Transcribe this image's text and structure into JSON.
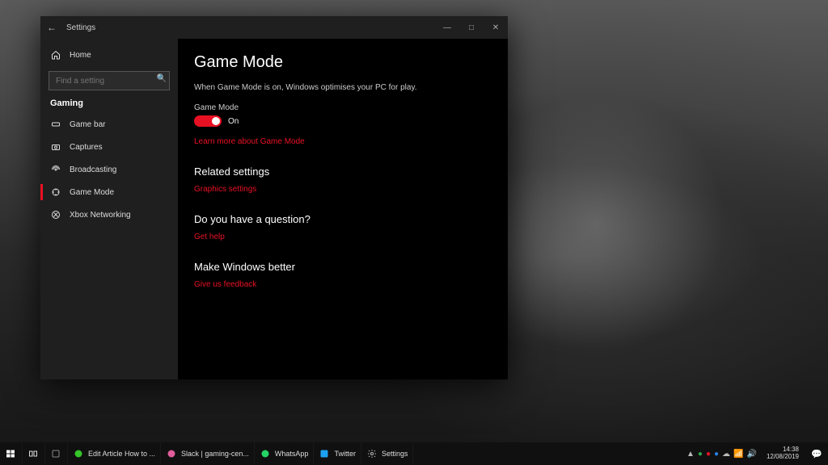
{
  "window": {
    "title": "Settings",
    "home_label": "Home",
    "search_placeholder": "Find a setting",
    "section_label": "Gaming",
    "sidebar_items": [
      {
        "label": "Game bar"
      },
      {
        "label": "Captures"
      },
      {
        "label": "Broadcasting"
      },
      {
        "label": "Game Mode"
      },
      {
        "label": "Xbox Networking"
      }
    ]
  },
  "main": {
    "heading": "Game Mode",
    "description": "When Game Mode is on, Windows optimises your PC for play.",
    "toggle_label": "Game Mode",
    "toggle_state": "On",
    "learn_more": "Learn more about Game Mode",
    "related_heading": "Related settings",
    "related_link": "Graphics settings",
    "question_heading": "Do you have a question?",
    "question_link": "Get help",
    "better_heading": "Make Windows better",
    "better_link": "Give us feedback"
  },
  "taskbar": {
    "apps": [
      {
        "label": "Edit Article How to ...",
        "color": "#35c42a"
      },
      {
        "label": "Slack | gaming-cen...",
        "color": "#e05e9b"
      },
      {
        "label": "WhatsApp",
        "color": "#25d366"
      },
      {
        "label": "Twitter",
        "color": "#1da1f2"
      },
      {
        "label": "Settings",
        "color": "#888888"
      }
    ],
    "time": "14:38",
    "date": "12/08/2019"
  }
}
